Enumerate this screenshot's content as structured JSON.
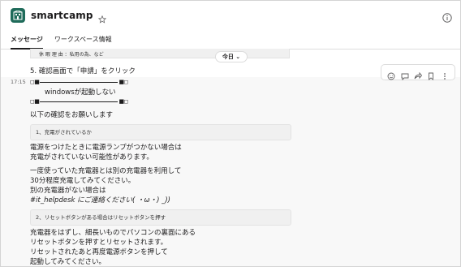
{
  "header": {
    "channel_name": "smartcamp",
    "logo_icon": "building-logo-icon",
    "star_icon": "star-icon",
    "info_icon": "info-icon"
  },
  "tabs": [
    {
      "label": "メッセージ",
      "active": true
    },
    {
      "label": "ワークスペース情報",
      "active": false
    }
  ],
  "previous_message": {
    "code_fragment": "休 暇 理 由 ：私用の為、など",
    "step_text": "5. 確認画面で「申請」をクリック"
  },
  "date_divider": {
    "label": "今日 ⌄"
  },
  "hover_actions": [
    "emoji-reaction-icon",
    "reply-thread-icon",
    "share-icon",
    "bookmark-icon",
    "more-options-icon"
  ],
  "message": {
    "time": "17:15",
    "sym_left": "◻■",
    "sym_right": "■◻",
    "title": "windowsが起動しない",
    "intro": "以下の確認をお願いします",
    "section1": "1、充電がされているか",
    "p1_line1": "電源をつけたときに電源ランプがつかない場合は",
    "p1_line2": "充電がされていない可能性があります。",
    "p2_line1": "一度使っていた充電器とは別の充電器を利用して",
    "p2_line2": "30分程度充電してみてください。",
    "p2_line3": "別の充電器がない場合は",
    "p2_line4": "#it_helpdesk にご連絡ください( ・ω・) _))",
    "section2": "2、リセットボタンがある場合はリセットボタンを押す",
    "p3_line1": "充電器をはずし、細長いものでパソコンの裏面にある",
    "p3_line2": "リセットボタンを押すとリセットされます。",
    "p3_line3": "リセットされたあと再度電源ボタンを押して",
    "p3_line4": "起動してみてください。"
  }
}
